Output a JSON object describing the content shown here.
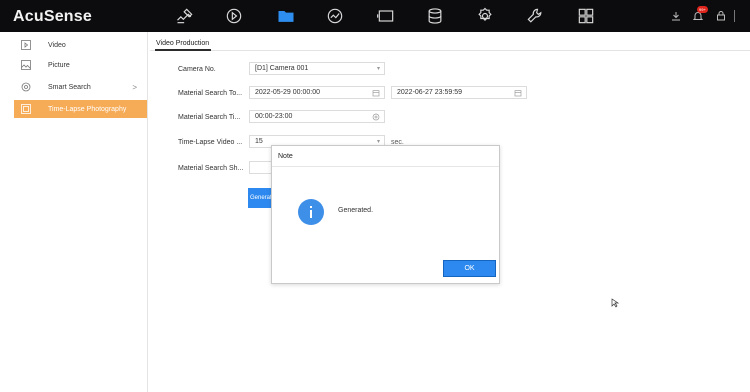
{
  "app": {
    "logo": "AcuSense"
  },
  "topnav": {
    "icons": [
      "camera-icon",
      "playback-icon",
      "folder-icon",
      "analytics-icon",
      "monitor-icon",
      "storage-icon",
      "settings-icon",
      "maintenance-icon",
      "grid-icon"
    ],
    "active": "folder-icon",
    "notification_badge": "99+"
  },
  "sidebar": {
    "items": [
      {
        "label": "Video",
        "icon": "video-file-icon"
      },
      {
        "label": "Picture",
        "icon": "picture-icon"
      },
      {
        "label": "Smart Search",
        "icon": "smart-search-icon",
        "chevron": ">"
      },
      {
        "label": "Time-Lapse Photography",
        "icon": "timelapse-icon",
        "active": true
      }
    ]
  },
  "main": {
    "tab_title": "Video Production",
    "form": {
      "camera_label": "Camera No.",
      "camera_value": "[D1] Camera 001",
      "material_search_time_label": "Material Search To...",
      "start_time": "2022-05-29 00:00:00",
      "end_time": "2022-06-27 23:59:59",
      "material_search_period_label": "Material Search Ti...",
      "period_value": "00:00-23:00",
      "timelapse_video_label": "Time-Lapse Video ...",
      "timelapse_value": "15",
      "timelapse_unit": "sec.",
      "material_search_sh_label": "Material Search Sh...",
      "generate_label": "Generate"
    }
  },
  "dialog": {
    "title": "Note",
    "message": "Generated.",
    "ok_label": "OK"
  },
  "colors": {
    "topbar": "#0c0c0e",
    "accent_blue": "#2d89ef",
    "active_orange": "#f6ab57",
    "active_nav": "#2e8ef0"
  }
}
